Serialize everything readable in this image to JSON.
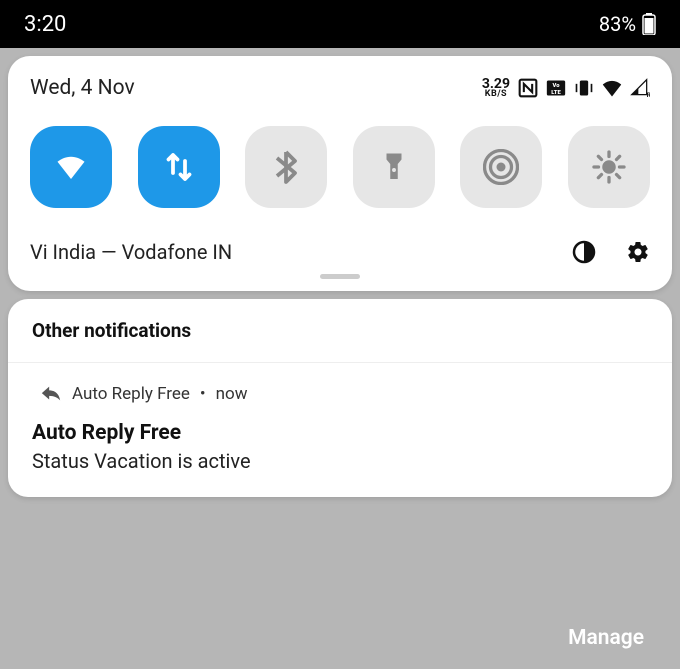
{
  "status_bar": {
    "time": "3:20",
    "battery_pct": "83%"
  },
  "quick_settings": {
    "date": "Wed, 4 Nov",
    "data_rate_value": "3.29",
    "data_rate_unit": "KB/S",
    "status_icons": [
      "nfc",
      "volte",
      "vibrate",
      "wifi",
      "signal-r"
    ],
    "toggles": [
      {
        "name": "wifi",
        "on": true
      },
      {
        "name": "mobile-data",
        "on": true
      },
      {
        "name": "bluetooth",
        "on": false
      },
      {
        "name": "flashlight",
        "on": false
      },
      {
        "name": "hotspot",
        "on": false
      },
      {
        "name": "brightness",
        "on": false
      }
    ],
    "carrier": "Vi India — Vodafone IN"
  },
  "notifications": {
    "group_header": "Other notifications",
    "items": [
      {
        "app_name": "Auto Reply Free",
        "time": "now",
        "title": "Auto Reply Free",
        "body": "Status Vacation is active"
      }
    ]
  },
  "footer": {
    "manage_label": "Manage"
  }
}
